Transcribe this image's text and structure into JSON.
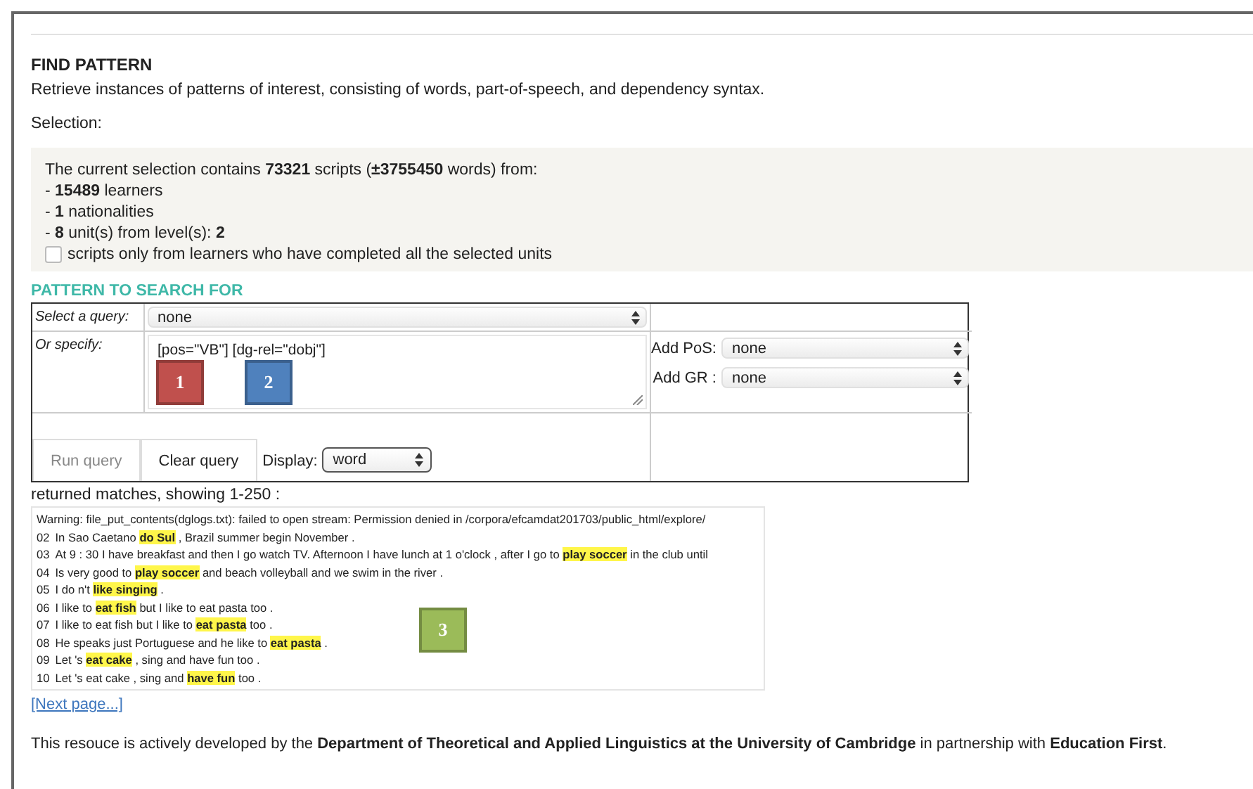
{
  "title": "FIND PATTERN",
  "description": "Retrieve instances of patterns of interest, consisting of words, part-of-speech, and dependency syntax.",
  "selection_label": "Selection:",
  "selection": {
    "lines": [
      "The current selection contains **73321** scripts (**±3755450** words) from:",
      "- **15489** learners",
      "- **1** nationalities",
      "- **8** unit(s) from level(s): **2**"
    ],
    "checkbox": {
      "label": "scripts only from learners who have completed all the selected units",
      "checked": false
    }
  },
  "pattern": {
    "heading": "PATTERN TO SEARCH FOR",
    "select_label": "Select a query:",
    "select_value": "none",
    "specify_label": "Or specify:",
    "specify_value": "[pos=\"VB\"] [dg-rel=\"dobj\"]",
    "pos_label": "Add PoS:",
    "pos_value": "none",
    "gr_label": "Add GR :",
    "gr_value": "none",
    "run_button": {
      "label": "Run query",
      "disabled": true
    },
    "clear_button": {
      "label": "Clear query",
      "disabled": false
    },
    "display_label": "Display:",
    "display_value": "word"
  },
  "results": {
    "heading": "returned matches, showing 1-250 :",
    "warning": "Warning: file_put_contents(dglogs.txt): failed to open stream: Permission denied in /corpora/efcamdat201703/public_html/explore/",
    "rows": [
      {
        "number": "02",
        "before": "In Sao Caetano ",
        "match": "do Sul",
        "after": " , Brazil summer begin November ."
      },
      {
        "number": "03",
        "before": "At 9 : 30 I have breakfast and then I go watch TV. Afternoon I have lunch at 1 o'clock , after I go to ",
        "match": "play soccer",
        "after": " in the club until"
      },
      {
        "number": "04",
        "before": "Is very good to ",
        "match": "play soccer",
        "after": " and beach volleyball and we swim in the river ."
      },
      {
        "number": "05",
        "before": "I do n't ",
        "match": "like singing",
        "after": " ."
      },
      {
        "number": "06",
        "before": "I like to ",
        "match": "eat fish",
        "after": " but I like to eat pasta too ."
      },
      {
        "number": "07",
        "before": "I like to eat fish but I like to ",
        "match": "eat pasta",
        "after": " too ."
      },
      {
        "number": "08",
        "before": "He speaks just Portuguese and he like to ",
        "match": "eat pasta",
        "after": " ."
      },
      {
        "number": "09",
        "before": "Let 's ",
        "match": "eat cake",
        "after": " , sing and have fun too ."
      },
      {
        "number": "10",
        "before": "Let 's eat cake , sing and ",
        "match": "have fun",
        "after": " too ."
      }
    ]
  },
  "next_page": "[Next page...]",
  "footer": "This resouce is actively developed by the **Department of Theoretical and Applied Linguistics at the University of Cambridge** in partnership with **Education First**.",
  "annotations": [
    {
      "label": "1",
      "color": "#c0504d"
    },
    {
      "label": "2",
      "color": "#4f81bd"
    },
    {
      "label": "3",
      "color": "#9bbb59"
    }
  ]
}
